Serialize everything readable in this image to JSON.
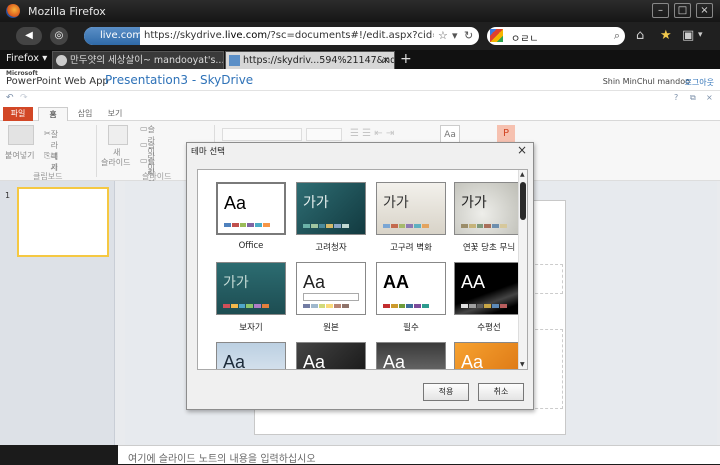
{
  "browser": {
    "title": "Mozilla Firefox",
    "url_site": "live.com",
    "url_prefix": "https://skydrive.",
    "url_domain": "live.com",
    "url_rest": "/?sc=documents#!/edit.aspx?cid=041E502D6B6",
    "search_query": "ㅇㄹㄴ",
    "firefox_menu": "Firefox",
    "tabs": [
      {
        "label": "만두얏의 세상살이~ mandooyat's..."
      },
      {
        "label": "https://skydriv...594%21147&nd=1"
      }
    ]
  },
  "app": {
    "ms_label": "Microsoft",
    "product": "PowerPoint Web App",
    "document": "Presentation3 - SkyDrive",
    "user": "Shin MinChul mandoo",
    "logout": "로그아웃"
  },
  "ribbon": {
    "tabs": [
      "파일",
      "홈",
      "삽입",
      "보기"
    ],
    "cut": "잘라내기",
    "copy": "복사",
    "paste": "붙여넣기",
    "clipboard": "클립보드",
    "new_slide_1": "새",
    "new_slide_2": "슬라이드",
    "delete_slide": "슬라이드 삭제",
    "slides_group": "슬라이드",
    "slide_item_2": "슬라이",
    "slide_item_3": "슬라이",
    "letters_aa": "Aa",
    "letters_p": "P"
  },
  "thumbnail": {
    "number": "1"
  },
  "notes": {
    "placeholder": "여기에 슬라이드 노트의 내용을 입력하십시오"
  },
  "dialog": {
    "title": "테마 선택",
    "close": "×",
    "apply": "적용",
    "cancel": "취소",
    "themes": [
      {
        "name": "Office",
        "sample": "Aa"
      },
      {
        "name": "고려청자",
        "sample": "가가"
      },
      {
        "name": "고구려 벽화",
        "sample": "가가"
      },
      {
        "name": "연꽃 당초 무늬",
        "sample": "가가"
      },
      {
        "name": "보자기",
        "sample": "가가"
      },
      {
        "name": "원본",
        "sample": "Aa"
      },
      {
        "name": "필수",
        "sample": "AA"
      },
      {
        "name": "수평선",
        "sample": "AA"
      },
      {
        "name": "",
        "sample": "Aa"
      },
      {
        "name": "",
        "sample": "Aa"
      },
      {
        "name": "",
        "sample": "Aa"
      },
      {
        "name": "",
        "sample": "Aa"
      }
    ]
  },
  "colors": {
    "accent": "#d24726",
    "link": "#2e72b8",
    "selection": "#f5c842"
  }
}
